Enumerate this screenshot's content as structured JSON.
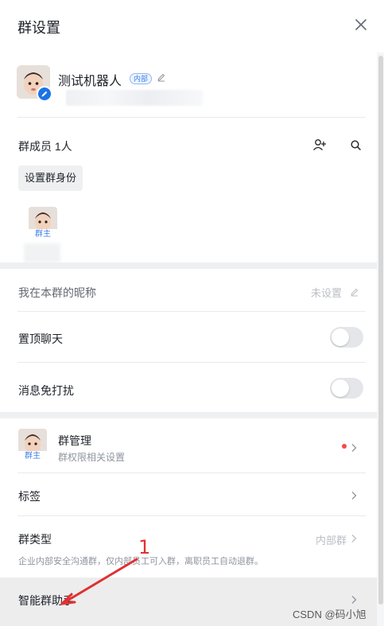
{
  "header": {
    "title": "群设置",
    "close_icon": "close-icon"
  },
  "group": {
    "name": "测试机器人",
    "badge": "内部",
    "avatar_icon": "baby-face-avatar",
    "edit_icon": "pencil-icon"
  },
  "members": {
    "label": "群成员 1人",
    "set_role_button": "设置群身份",
    "owner_tag": "群主",
    "add_icon": "add-user-icon",
    "search_icon": "search-icon"
  },
  "settings": {
    "nickname_label": "我在本群的昵称",
    "nickname_value": "未设置",
    "pin_chat_label": "置顶聊天",
    "pin_chat_on": false,
    "mute_label": "消息免打扰",
    "mute_on": false
  },
  "management": {
    "title": "群管理",
    "subtitle": "群权限相关设置",
    "owner_tag": "群主",
    "has_notification": true
  },
  "tags": {
    "label": "标签"
  },
  "group_type": {
    "label": "群类型",
    "value": "内部群",
    "description": "企业内部安全沟通群，仅内部员工可入群，离职员工自动退群。"
  },
  "assistant": {
    "label": "智能群助手"
  },
  "annotation": {
    "number": "1",
    "color": "#e03131"
  },
  "watermark": "CSDN @码小旭",
  "colors": {
    "accent": "#1a73e8",
    "badge_blue": "#3c7fe6",
    "notify_red": "#f54a45"
  }
}
